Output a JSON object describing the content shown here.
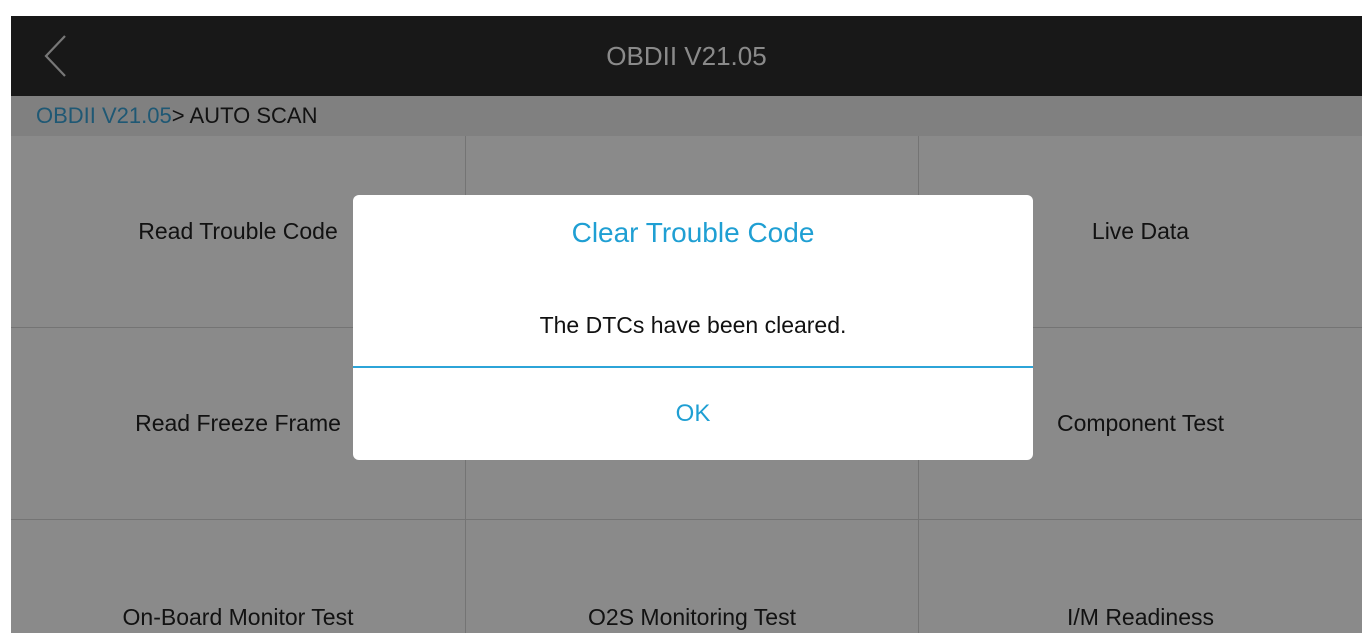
{
  "header": {
    "title": "OBDII V21.05",
    "back_icon": "chevron-left-icon"
  },
  "breadcrumb": {
    "root": "OBDII V21.05",
    "separator": ">",
    "current": " AUTO SCAN"
  },
  "menu": {
    "items": [
      {
        "label": "Read Trouble Code"
      },
      {
        "label": ""
      },
      {
        "label": "Live Data"
      },
      {
        "label": "Read Freeze Frame"
      },
      {
        "label": ""
      },
      {
        "label": "Component Test"
      },
      {
        "label": "On-Board Monitor Test"
      },
      {
        "label": "O2S Monitoring Test"
      },
      {
        "label": "I/M Readiness"
      }
    ]
  },
  "dialog": {
    "title": "Clear Trouble Code",
    "message": "The DTCs have been cleared.",
    "ok_label": "OK"
  },
  "colors": {
    "titlebar": "#2e2e2e",
    "accent": "#1f9fd3",
    "overlay": "rgba(0,0,0,0.46)"
  }
}
